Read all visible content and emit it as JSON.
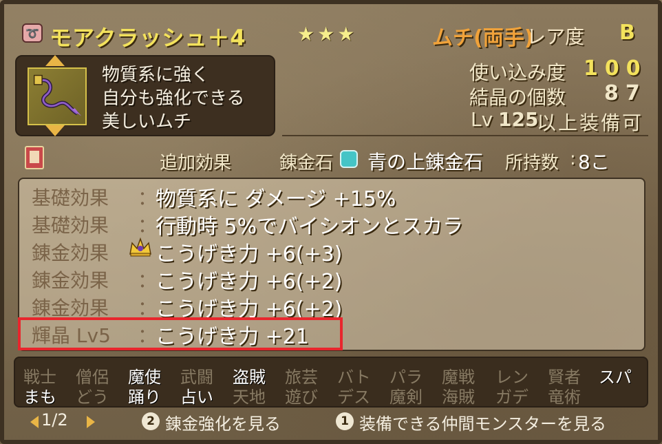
{
  "title": {
    "name": "モアクラッシュ＋4",
    "stars": "★★★",
    "weapon_type": "ムチ(両手)",
    "rarity_label": "レア度",
    "rarity_value": "B"
  },
  "description": [
    "物質系に強く",
    "自分も強化できる",
    "美しいムチ"
  ],
  "stats": {
    "usage_label": "使い込み度",
    "usage_value": "100",
    "crystal_label": "結晶の個数",
    "crystal_value": "87",
    "equip_lv_prefix": "Lv",
    "equip_lv_value": "125",
    "equip_lv_suffix": "以上装備可"
  },
  "bonus_row": {
    "extra_effect_label": "追加効果",
    "alchemy_stone_label": "錬金石",
    "stone_name": "青の上錬金石",
    "owned_label": "所持数",
    "owned_value": "8こ"
  },
  "effects": [
    {
      "label": "基礎効果",
      "value": "物質系に ダメージ +15%",
      "marker": "："
    },
    {
      "label": "基礎効果",
      "value": "行動時 5%でバイシオンとスカラ",
      "marker": "："
    },
    {
      "label": "錬金効果",
      "value": "こうげき力 +6(+3)",
      "marker": "crown"
    },
    {
      "label": "錬金効果",
      "value": "こうげき力 +6(+2)",
      "marker": "："
    },
    {
      "label": "錬金効果",
      "value": "こうげき力 +6(+2)",
      "marker": "："
    },
    {
      "label": "輝晶 Lv5",
      "value": "こうげき力 +21",
      "marker": "："
    }
  ],
  "jobs": {
    "row1": [
      {
        "name": "戦士",
        "enabled": false
      },
      {
        "name": "僧侶",
        "enabled": false
      },
      {
        "name": "魔使",
        "enabled": true
      },
      {
        "name": "武闘",
        "enabled": false
      },
      {
        "name": "盗賊",
        "enabled": true
      },
      {
        "name": "旅芸",
        "enabled": false
      },
      {
        "name": "バト",
        "enabled": false
      },
      {
        "name": "パラ",
        "enabled": false
      },
      {
        "name": "魔戦",
        "enabled": false
      },
      {
        "name": "レン",
        "enabled": false
      },
      {
        "name": "賢者",
        "enabled": false
      },
      {
        "name": "スパ",
        "enabled": true
      }
    ],
    "row2": [
      {
        "name": "まも",
        "enabled": true
      },
      {
        "name": "どう",
        "enabled": false
      },
      {
        "name": "踊り",
        "enabled": true
      },
      {
        "name": "占い",
        "enabled": true
      },
      {
        "name": "天地",
        "enabled": false
      },
      {
        "name": "遊び",
        "enabled": false
      },
      {
        "name": "デス",
        "enabled": false
      },
      {
        "name": "魔剣",
        "enabled": false
      },
      {
        "name": "海賊",
        "enabled": false
      },
      {
        "name": "ガデ",
        "enabled": false
      },
      {
        "name": "竜術",
        "enabled": false
      }
    ]
  },
  "footer": {
    "page": "1/2",
    "btn2_num": "2",
    "btn2_label": "錬金強化を見る",
    "btn1_num": "1",
    "btn1_label": "装備できる仲間モンスターを見る"
  },
  "colors": {
    "title": "#f3e25c",
    "weapon_type": "#f0a23a",
    "highlight_border": "#e8262d",
    "usage_value": "#f3e25c",
    "crystal_value": "#f1e7c9"
  }
}
